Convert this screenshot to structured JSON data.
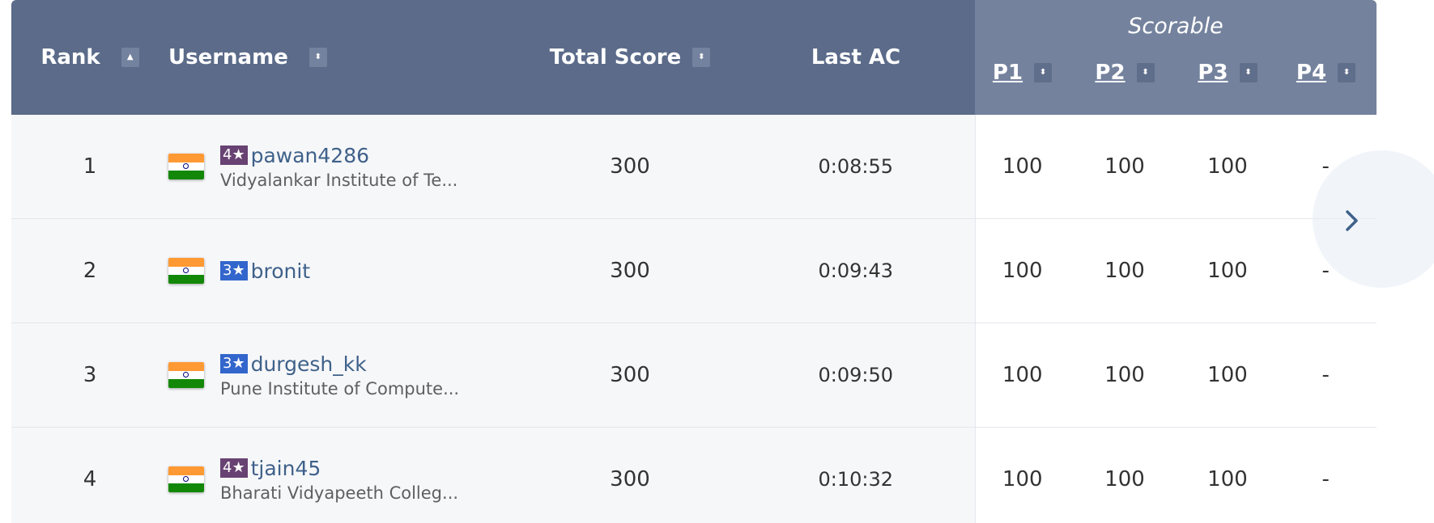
{
  "header": {
    "scorable": "Scorable",
    "rank": "Rank",
    "rank_sort": "▲",
    "username": "Username",
    "username_sort": "⬍",
    "total_score": "Total Score",
    "total_score_sort": "⬍",
    "last_ac": "Last AC",
    "problems": [
      {
        "label": "P1",
        "sort": "⬍"
      },
      {
        "label": "P2",
        "sort": "⬍"
      },
      {
        "label": "P3",
        "sort": "⬍"
      },
      {
        "label": "P4",
        "sort": "⬍"
      }
    ]
  },
  "rows": [
    {
      "rank": "1",
      "stars": "4★",
      "star_color": "#684273",
      "username": "pawan4286",
      "institution": "Vidyalankar Institute of Te...",
      "total": "300",
      "last_ac": "0:08:55",
      "scores": [
        "100",
        "100",
        "100",
        "-"
      ],
      "flag_icon": "india-flag-icon"
    },
    {
      "rank": "2",
      "stars": "3★",
      "star_color": "#3366cc",
      "username": "bronit",
      "institution": "",
      "total": "300",
      "last_ac": "0:09:43",
      "scores": [
        "100",
        "100",
        "100",
        "-"
      ],
      "flag_icon": "india-flag-icon"
    },
    {
      "rank": "3",
      "stars": "3★",
      "star_color": "#3366cc",
      "username": "durgesh_kk",
      "institution": "Pune Institute of Compute...",
      "total": "300",
      "last_ac": "0:09:50",
      "scores": [
        "100",
        "100",
        "100",
        "-"
      ],
      "flag_icon": "india-flag-icon"
    },
    {
      "rank": "4",
      "stars": "4★",
      "star_color": "#684273",
      "username": "tjain45",
      "institution": "Bharati Vidyapeeth Colleg...",
      "total": "300",
      "last_ac": "0:10:32",
      "scores": [
        "100",
        "100",
        "100",
        "-"
      ],
      "flag_icon": "india-flag-icon"
    }
  ],
  "colors": {
    "header_main": "#5b6b89",
    "header_scorable": "#74829d",
    "row_bg": "#f6f7f9",
    "username_link": "#3f618a"
  },
  "icons": {
    "next": "chevron-right-icon",
    "sort": "sort-arrows-icon",
    "flag": "india-flag-icon"
  }
}
